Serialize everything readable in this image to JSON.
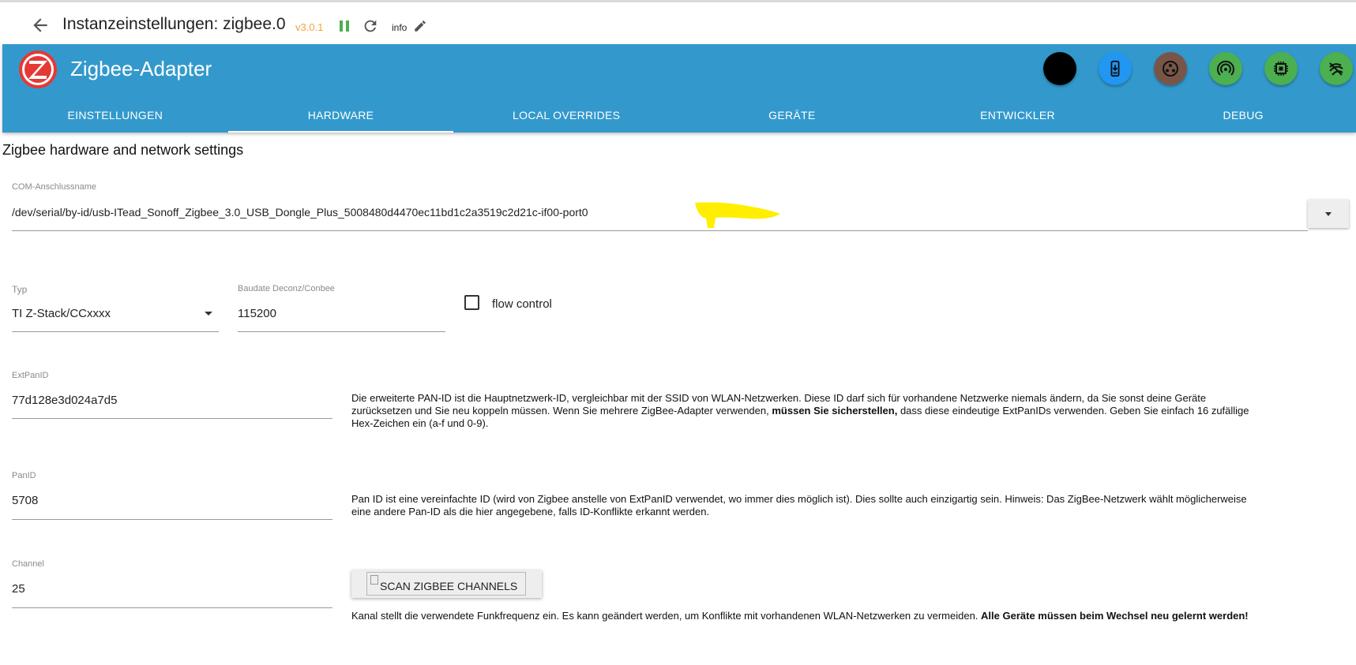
{
  "header": {
    "title": "Instanzeinstellungen: zigbee.0",
    "version": "v3.0.1",
    "loglevel": "info"
  },
  "appbar": {
    "title": "Zigbee-Adapter",
    "colors": {
      "bar": "#3399cc",
      "accent": "#4caf50"
    },
    "action_buttons": [
      {
        "icon": "black-circle-icon",
        "color": "#000000"
      },
      {
        "icon": "download-phone-icon",
        "color": "#2196f3"
      },
      {
        "icon": "settings-group-icon",
        "color": "#795548"
      },
      {
        "icon": "wireless-icon",
        "color": "#4caf50"
      },
      {
        "icon": "chip-icon",
        "color": "#4caf50"
      },
      {
        "icon": "signal-icon",
        "color": "#4caf50"
      }
    ],
    "tabs": [
      {
        "label": "EINSTELLUNGEN"
      },
      {
        "label": "HARDWARE"
      },
      {
        "label": "LOCAL OVERRIDES"
      },
      {
        "label": "GERÄTE"
      },
      {
        "label": "ENTWICKLER"
      },
      {
        "label": "DEBUG"
      }
    ],
    "active_tab": "HARDWARE"
  },
  "form": {
    "section_title": "Zigbee hardware and network settings",
    "port": {
      "label": "COM-Anschlussname",
      "value": "/dev/serial/by-id/usb-ITead_Sonoff_Zigbee_3.0_USB_Dongle_Plus_5008480d4470ec11bd1c2a3519c2d21c-if00-port0"
    },
    "type": {
      "label": "Typ",
      "value": "TI Z-Stack/CCxxxx"
    },
    "baudrate": {
      "label": "Baudate Deconz/Conbee",
      "value": "115200"
    },
    "flow_control": {
      "label": "flow control",
      "checked": false
    },
    "extpanid": {
      "label": "ExtPanID",
      "value": "77d128e3d024a7d5",
      "help_1": "Die erweiterte PAN-ID ist die Hauptnetzwerk-ID, vergleichbar mit der SSID von WLAN-Netzwerken. Diese ID darf sich für vorhandene Netzwerke niemals ändern, da Sie sonst deine Geräte zurücksetzen und Sie neu koppeln müssen. Wenn Sie mehrere ZigBee-Adapter verwenden,",
      "help_bold": "müssen Sie sicherstellen,",
      "help_2": "dass diese eindeutige ExtPanIDs verwenden. Geben Sie einfach 16 zufällige Hex-Zeichen ein (a-f und 0-9)."
    },
    "panid": {
      "label": "PanID",
      "value": "5708",
      "help": "Pan ID ist eine vereinfachte ID (wird von Zigbee anstelle von ExtPanID verwendet, wo immer dies möglich ist). Dies sollte auch einzigartig sein. Hinweis: Das ZigBee-Netzwerk wählt möglicherweise eine andere Pan-ID als die hier angegebene, falls ID-Konflikte erkannt werden."
    },
    "channel": {
      "label": "Channel",
      "value": "25",
      "scan_button": "SCAN ZIGBEE CHANNELS",
      "help_1": "Kanal stellt die verwendete Funkfrequenz ein. Es kann geändert werden, um Konflikte mit vorhandenen WLAN-Netzwerken zu vermeiden.",
      "help_bold": "Alle Geräte müssen beim Wechsel neu gelernt werden!"
    }
  }
}
